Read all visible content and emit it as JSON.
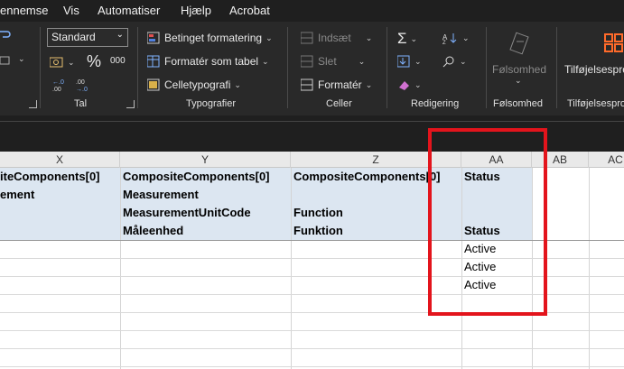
{
  "menu": {
    "items": [
      "ennemse",
      "Vis",
      "Automatiser",
      "Hjælp",
      "Acrobat"
    ]
  },
  "ribbon": {
    "number": {
      "format_value": "Standard",
      "percent_symbol": "%",
      "thousands_symbol": "000",
      "group_label": "Tal"
    },
    "styles": {
      "conditional_formatting": "Betinget formatering",
      "format_as_table": "Formatér som tabel",
      "cell_styles": "Celletypografi",
      "group_label": "Typografier"
    },
    "cells": {
      "insert": "Indsæt",
      "delete": "Slet",
      "format": "Formatér",
      "group_label": "Celler"
    },
    "editing": {
      "sum_symbol": "Σ",
      "group_label": "Redigering"
    },
    "sensitivity": {
      "button_label": "Følsomhed",
      "group_label": "Følsomhed"
    },
    "addins": {
      "button_label": "Tilføjelsespro",
      "group_label": "Tilføjelsespro"
    }
  },
  "sheet": {
    "columns": [
      "X",
      "Y",
      "Z",
      "AA",
      "AB",
      "AC"
    ],
    "header_rows": [
      [
        "iteComponents[0]",
        "CompositeComponents[0]",
        "CompositeComponents[0]",
        "Status"
      ],
      [
        "ement",
        "Measurement",
        "",
        ""
      ],
      [
        "",
        "MeasurementUnitCode",
        "Function",
        ""
      ],
      [
        "",
        "Måleenhed",
        "Funktion",
        "Status"
      ]
    ],
    "status_values": [
      "Active",
      "Active",
      "Active"
    ]
  },
  "colors": {
    "highlight_border": "#e3141c",
    "header_band": "#dce6f1",
    "ribbon_bg": "#292929"
  }
}
